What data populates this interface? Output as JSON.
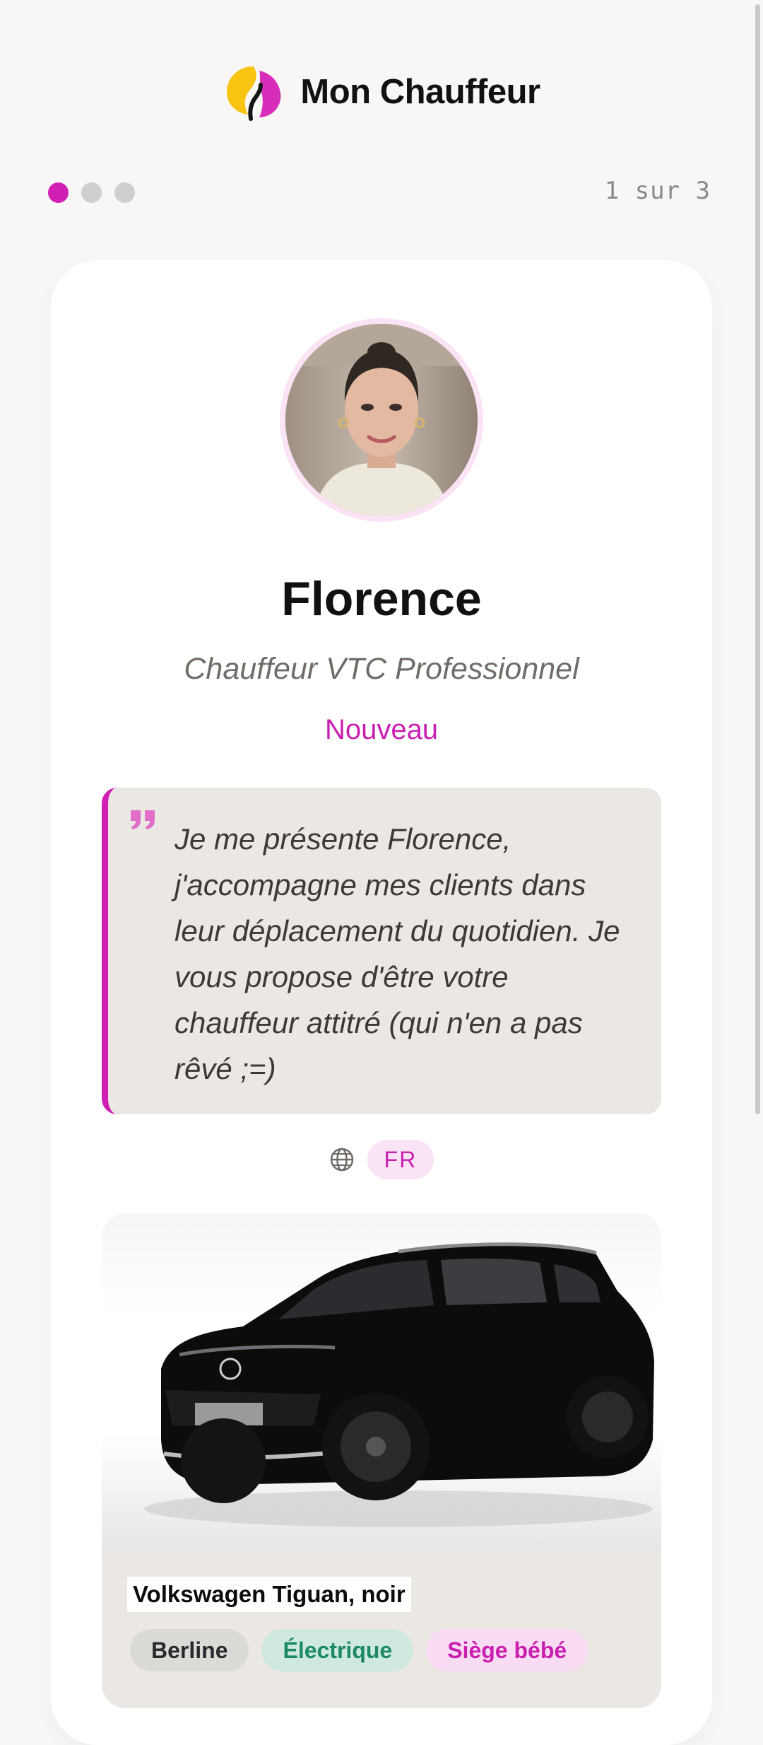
{
  "app": {
    "name": "Mon Chauffeur",
    "logo_icon": "mon-chauffeur-logo-icon"
  },
  "progress": {
    "current": 1,
    "total": 3,
    "label": "1 sur 3"
  },
  "profile": {
    "name": "Florence",
    "role": "Chauffeur VTC Professionnel",
    "status": "Nouveau",
    "bio": "Je me présente Florence, j'accompagne mes clients dans leur déplacement du quotidien. Je vous propose d'être votre chauffeur attitré (qui n'en a pas rêvé ;=)",
    "languages": [
      "FR"
    ]
  },
  "vehicle": {
    "model": "Volkswagen Tiguan, noir",
    "tags": [
      "Berline",
      "Électrique",
      "Siège bébé"
    ]
  },
  "colors": {
    "accent": "#d11fb4",
    "background": "#f8f7f5",
    "quote_bg": "#ebe7e3"
  }
}
